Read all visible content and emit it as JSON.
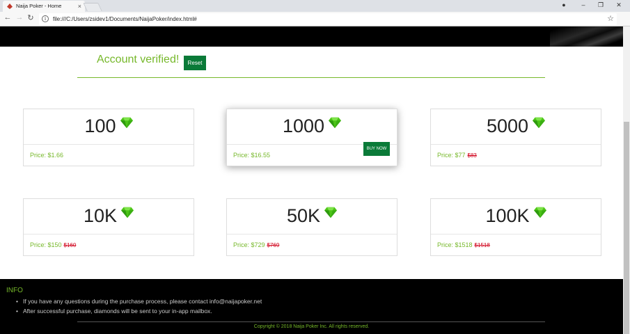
{
  "browser": {
    "tab_title": "Naija Poker - Home",
    "url": "file:///C:/Users/zsidev1/Documents/NaijaPoker/index.html#",
    "icons": {
      "favicon": "naija-poker-favicon",
      "close": "close-icon",
      "back": "back-arrow-icon",
      "forward": "forward-arrow-icon",
      "reload": "reload-icon",
      "info": "info-icon",
      "bookmark": "star-icon",
      "menu": "kebab-menu-icon",
      "account": "account-icon",
      "minimize": "minimize-icon",
      "restore": "restore-icon",
      "window_close": "window-close-icon"
    }
  },
  "page": {
    "status_text": "Account verified!",
    "reset_label": "Reset",
    "packages": [
      {
        "amount": "100",
        "price": "Price: $1.66",
        "old_price": ""
      },
      {
        "amount": "1000",
        "price": "Price: $16.55",
        "old_price": "",
        "buy_label": "BUY NOW"
      },
      {
        "amount": "5000",
        "price": "Price: $77",
        "old_price": "$83"
      },
      {
        "amount": "10K",
        "price": "Price: $150",
        "old_price": "$160"
      },
      {
        "amount": "50K",
        "price": "Price: $729",
        "old_price": "$769"
      },
      {
        "amount": "100K",
        "price": "Price: $1518",
        "old_price": "$1518"
      }
    ],
    "icon": "diamond-icon",
    "colors": {
      "accent": "#76b82a",
      "button": "#0a7a38",
      "strike": "#d0021b"
    }
  },
  "footer": {
    "title": "INFO",
    "items": [
      "If you have any questions during the purchase process, please contact info@naijapoker.net",
      "After successful purchase, diamonds will be sent to your in-app mailbox."
    ],
    "copyright": "Copyright © 2018 Naija Poker Inc. All rights reserved."
  }
}
